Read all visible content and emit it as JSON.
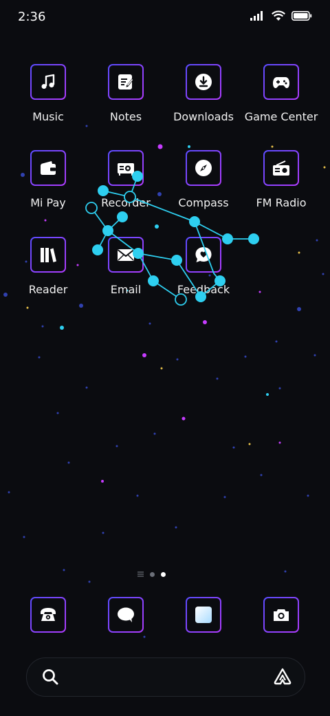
{
  "status_bar": {
    "time": "2:36",
    "icons": [
      "signal-icon",
      "wifi-icon",
      "battery-icon"
    ]
  },
  "apps": [
    {
      "label": "Music",
      "icon": "music-note-icon"
    },
    {
      "label": "Notes",
      "icon": "notes-icon"
    },
    {
      "label": "Downloads",
      "icon": "download-icon"
    },
    {
      "label": "Game Center",
      "icon": "gamepad-icon"
    },
    {
      "label": "Mi Pay",
      "icon": "wallet-icon"
    },
    {
      "label": "Recorder",
      "icon": "recorder-icon"
    },
    {
      "label": "Compass",
      "icon": "compass-icon"
    },
    {
      "label": "FM Radio",
      "icon": "radio-icon"
    },
    {
      "label": "Reader",
      "icon": "books-icon"
    },
    {
      "label": "Email",
      "icon": "mail-icon"
    },
    {
      "label": "Feedback",
      "icon": "feedback-icon"
    }
  ],
  "dock": [
    {
      "icon": "phone-icon"
    },
    {
      "icon": "message-icon"
    },
    {
      "icon": "gallery-icon"
    },
    {
      "icon": "camera-icon"
    }
  ],
  "page_indicator": {
    "pages": 2,
    "active": 2
  },
  "search": {
    "left_icon": "search-icon",
    "right_icon": "assistant-icon"
  },
  "colors": {
    "background": "#0b0c10",
    "tile_gradient_start": "#5b4cff",
    "tile_gradient_end": "#b03cff",
    "constellation": "#2ecff0"
  }
}
